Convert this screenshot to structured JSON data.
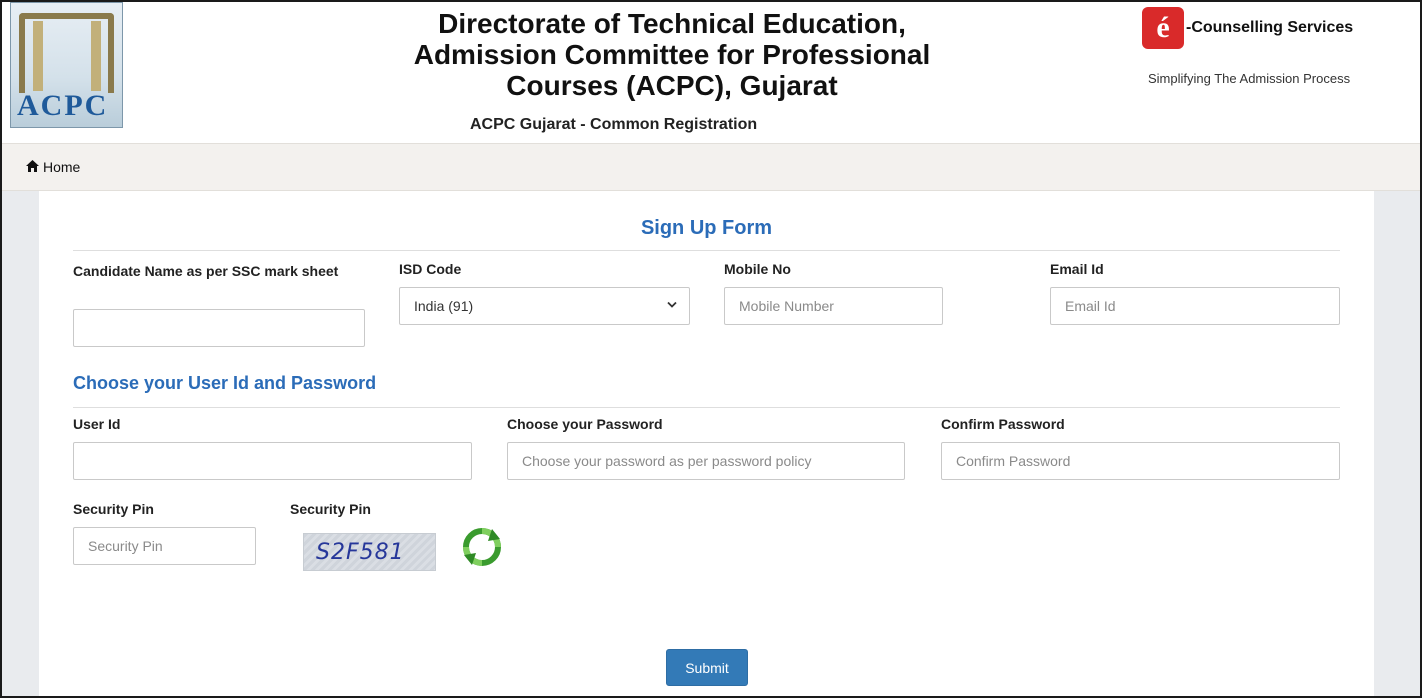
{
  "header": {
    "logo_text": "ACPC",
    "title_line1": "Directorate of Technical Education,",
    "title_line2": "Admission Committee for Professional",
    "title_line3": "Courses (ACPC), Gujarat",
    "subtitle": "ACPC Gujarat - Common Registration",
    "brand_icon_letter": "é",
    "brand_name": "-Counselling Services",
    "brand_tagline": "Simplifying The Admission Process"
  },
  "nav": {
    "home_label": "Home",
    "home_icon": "home-icon"
  },
  "form": {
    "title": "Sign Up Form",
    "candidate_name_label": "Candidate Name as per SSC mark sheet",
    "candidate_name_value": "",
    "isd_label": "ISD Code",
    "isd_selected": "India (91)",
    "mobile_label": "Mobile No",
    "mobile_placeholder": "Mobile Number",
    "email_label": "Email Id",
    "email_placeholder": "Email Id",
    "credentials_title": "Choose your User Id and Password",
    "userid_label": "User Id",
    "userid_value": "",
    "password_label": "Choose your Password",
    "password_placeholder": "Choose your password as per password policy",
    "confirm_label": "Confirm Password",
    "confirm_placeholder": "Confirm Password",
    "pin_label": "Security Pin",
    "pin_placeholder": "Security Pin",
    "captcha_label": "Security Pin",
    "captcha_text": "S2F581",
    "refresh_icon": "refresh-icon",
    "submit_label": "Submit"
  },
  "colors": {
    "accent": "#2b6cb8",
    "button": "#337ab7",
    "nav_bg": "#f3f1ee",
    "content_bg": "#e9ebee",
    "brand_red": "#d92a2a"
  }
}
